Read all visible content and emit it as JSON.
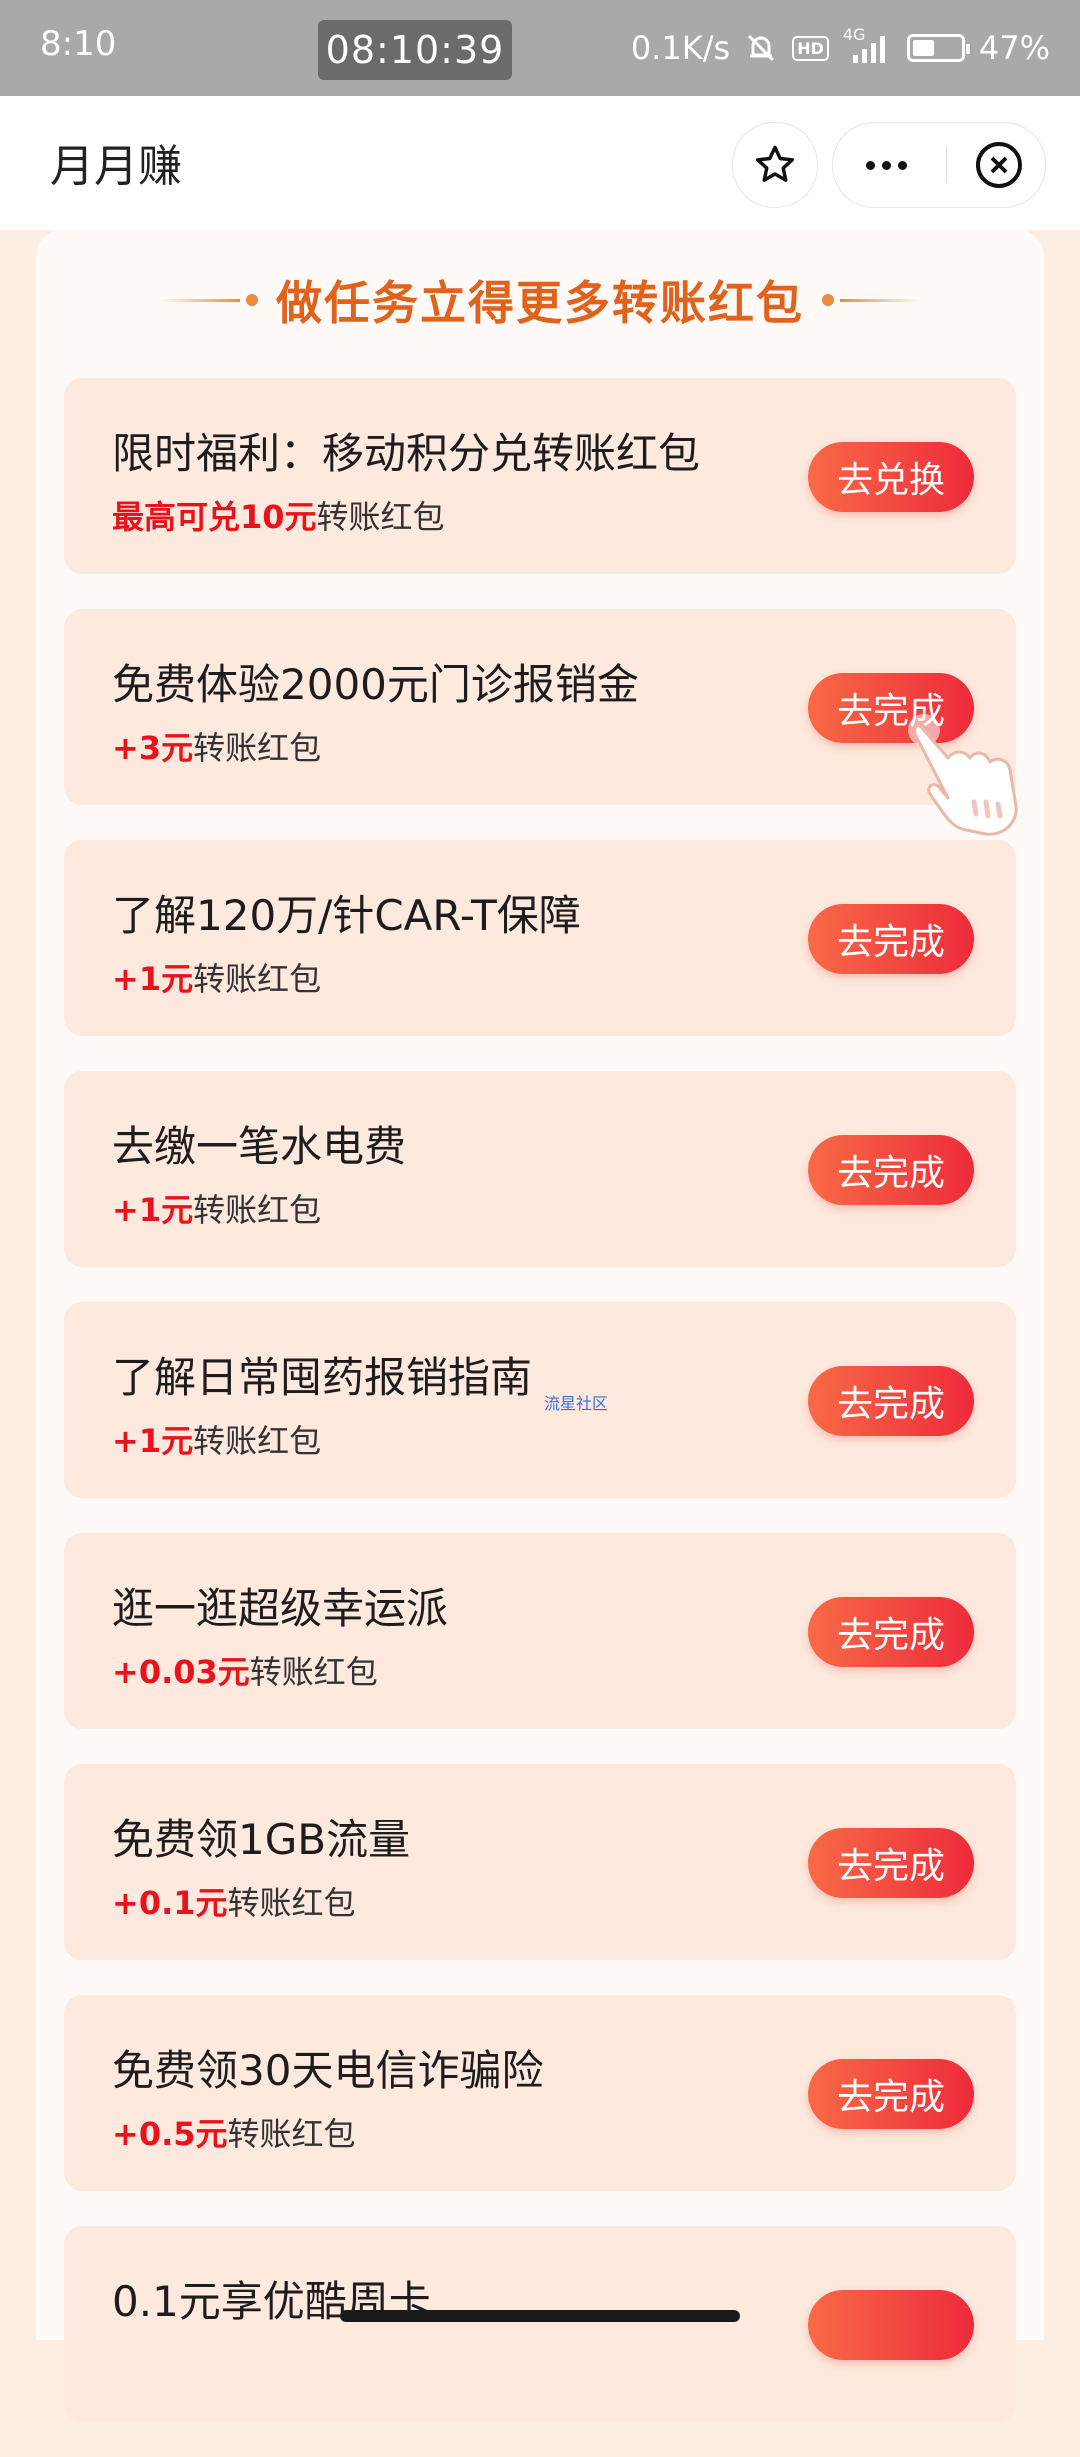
{
  "status_bar": {
    "time": "8:10",
    "clock": "08:10:39",
    "net_speed": "0.1K/s",
    "hd": "HD",
    "network": "4G",
    "battery_pct": "47%",
    "battery_level": 0.47
  },
  "title_bar": {
    "title": "月月赚",
    "icons": [
      "star-icon",
      "more-icon",
      "close-icon"
    ]
  },
  "section": {
    "heading": "做任务立得更多转账红包"
  },
  "tasks": [
    {
      "title": "限时福利：移动积分兑转账红包",
      "reward_amount": "最高可兑10元",
      "reward_suffix": "转账红包",
      "button": "去兑换"
    },
    {
      "title": "免费体验2000元门诊报销金",
      "reward_amount": "+3元",
      "reward_suffix": "转账红包",
      "button": "去完成"
    },
    {
      "title": "了解120万/针CAR-T保障",
      "reward_amount": "+1元",
      "reward_suffix": "转账红包",
      "button": "去完成"
    },
    {
      "title": "去缴一笔水电费",
      "reward_amount": "+1元",
      "reward_suffix": "转账红包",
      "button": "去完成"
    },
    {
      "title": "了解日常囤药报销指南",
      "reward_amount": "+1元",
      "reward_suffix": "转账红包",
      "button": "去完成"
    },
    {
      "title": "逛一逛超级幸运派",
      "reward_amount": "+0.03元",
      "reward_suffix": "转账红包",
      "button": "去完成"
    },
    {
      "title": "免费领1GB流量",
      "reward_amount": "+0.1元",
      "reward_suffix": "转账红包",
      "button": "去完成"
    },
    {
      "title": "免费领30天电信诈骗险",
      "reward_amount": "+0.5元",
      "reward_suffix": "转账红包",
      "button": "去完成"
    },
    {
      "title": "0.1元享优酷周卡",
      "reward_amount": "",
      "reward_suffix": "",
      "button": ""
    }
  ],
  "watermark": "流星社区",
  "colors": {
    "accent": "#e0621b",
    "button_start": "#f86a46",
    "button_end": "#ed2b3b",
    "reward_red": "#e8131c",
    "card_bg": "#fde9dd"
  }
}
